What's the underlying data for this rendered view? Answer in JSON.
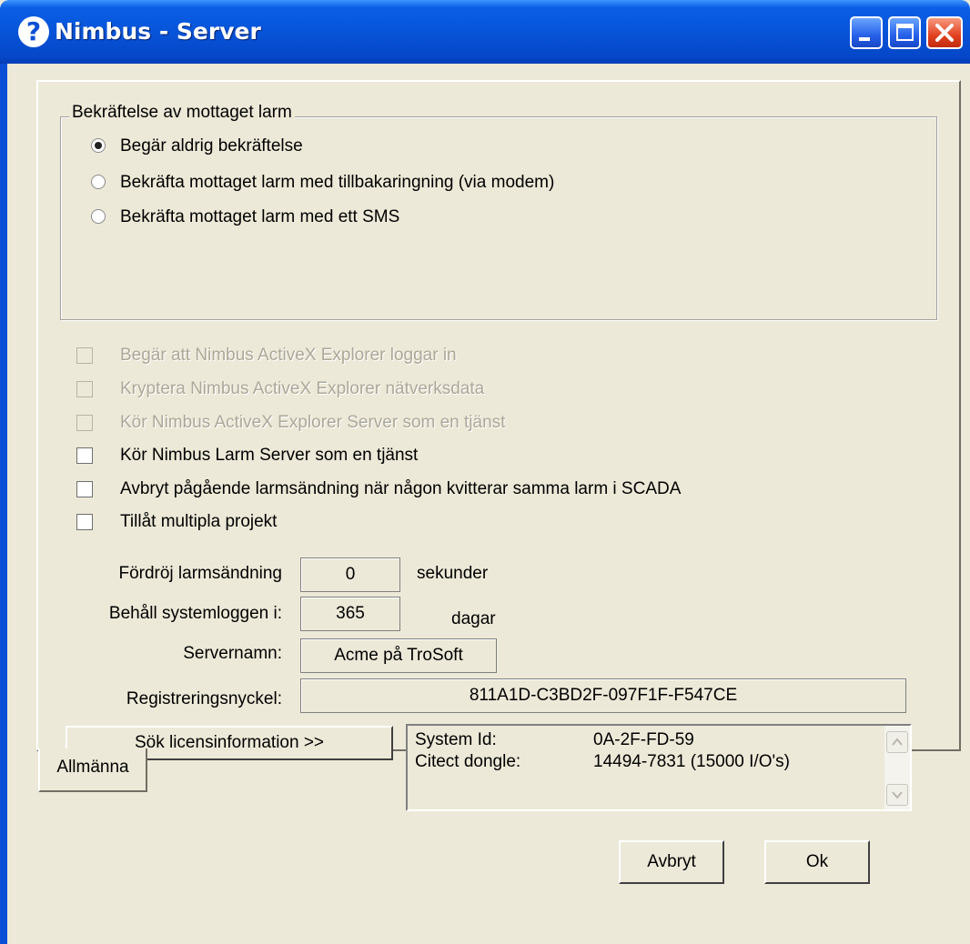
{
  "window": {
    "title": "Nimbus - Server",
    "icon": "question-mark-icon",
    "controls": [
      "minimize-icon",
      "maximize-icon",
      "close-icon"
    ]
  },
  "confirmation_group": {
    "title": "Bekräftelse av mottaget larm",
    "options": [
      {
        "label": "Begär aldrig bekräftelse",
        "checked": true
      },
      {
        "label": "Bekräfta mottaget larm med tillbakaringning (via modem)",
        "checked": false
      },
      {
        "label": "Bekräfta mottaget larm med ett SMS",
        "checked": false
      }
    ]
  },
  "checkboxes": [
    {
      "label": "Begär att Nimbus ActiveX Explorer loggar in",
      "enabled": false,
      "checked": false
    },
    {
      "label": "Kryptera Nimbus ActiveX Explorer nätverksdata",
      "enabled": false,
      "checked": false
    },
    {
      "label": "Kör Nimbus ActiveX Explorer Server som en tjänst",
      "enabled": false,
      "checked": false
    },
    {
      "label": "Kör Nimbus Larm Server som en tjänst",
      "enabled": true,
      "checked": false
    },
    {
      "label": "Avbryt pågående larmsändning när någon kvitterar samma larm i SCADA",
      "enabled": true,
      "checked": false
    },
    {
      "label": "Tillåt multipla projekt",
      "enabled": true,
      "checked": false
    }
  ],
  "fields": {
    "delay": {
      "label": "Fördröj larmsändning",
      "value": "0",
      "unit": "sekunder"
    },
    "log_retention": {
      "label": "Behåll systemloggen i:",
      "value": "365",
      "unit": "dagar"
    },
    "server_name": {
      "label": "Servernamn:",
      "value": "Acme på TroSoft"
    },
    "registration_key": {
      "label": "Registreringsnyckel:",
      "value": "811A1D-C3BD2F-097F1F-F547CE"
    }
  },
  "license": {
    "button_label": "Sök licensinformation >>",
    "rows": [
      {
        "key": "System Id:",
        "value": "0A-2F-FD-59"
      },
      {
        "key": "Citect dongle:",
        "value": "14494-7831 (15000 I/O's)"
      }
    ]
  },
  "tabs": [
    {
      "label": "Allmänna",
      "active": true
    }
  ],
  "buttons": {
    "cancel": "Avbryt",
    "ok": "Ok"
  }
}
